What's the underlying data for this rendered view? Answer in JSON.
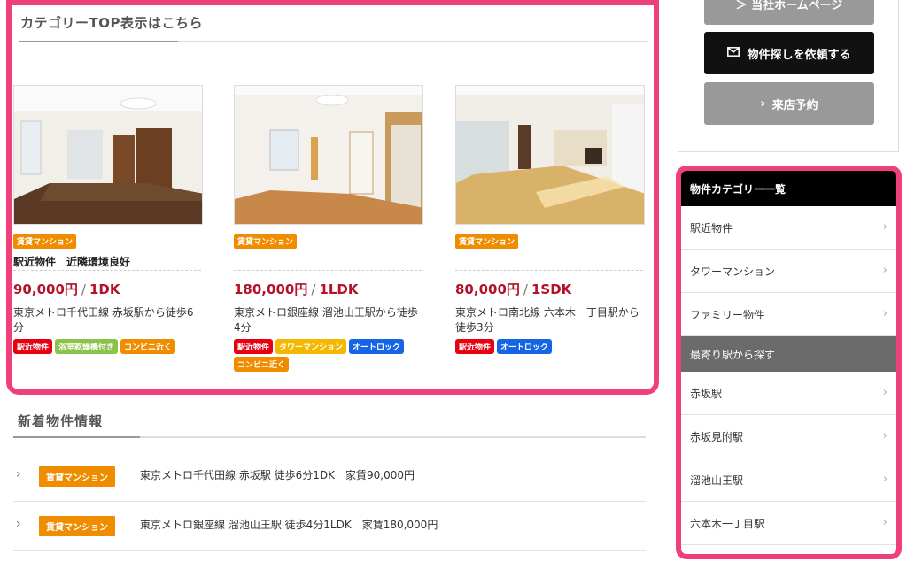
{
  "main": {
    "section_title": "カテゴリーTOP表示はこちら",
    "cards": [
      {
        "category": "賃貸マンション",
        "title": "駅近物件　近隣環境良好",
        "price": "90,000円",
        "layout": "1DK",
        "access": "東京メトロ千代田線 赤坂駅から徒歩6分",
        "tags": [
          {
            "label": "駅近物件",
            "color": "#e60012"
          },
          {
            "label": "浴室乾燥機付き",
            "color": "#8bc34a"
          },
          {
            "label": "コンビニ近く",
            "color": "#f08c00"
          }
        ]
      },
      {
        "category": "賃貸マンション",
        "title": "",
        "price": "180,000円",
        "layout": "1LDK",
        "access": "東京メトロ銀座線 溜池山王駅から徒歩4分",
        "tags": [
          {
            "label": "駅近物件",
            "color": "#e60012"
          },
          {
            "label": "タワーマンション",
            "color": "#f5b800"
          },
          {
            "label": "オートロック",
            "color": "#1565e6"
          },
          {
            "label": "コンビニ近く",
            "color": "#f08c00"
          }
        ]
      },
      {
        "category": "賃貸マンション",
        "title": "",
        "price": "80,000円",
        "layout": "1SDK",
        "access": "東京メトロ南北線 六本木一丁目駅から徒歩3分",
        "tags": [
          {
            "label": "駅近物件",
            "color": "#e60012"
          },
          {
            "label": "オートロック",
            "color": "#1565e6"
          }
        ]
      }
    ]
  },
  "news": {
    "title": "新着物件情報",
    "items": [
      {
        "category": "賃貸マンション",
        "text": "東京メトロ千代田線 赤坂駅 徒歩6分1DK　家賃90,000円"
      },
      {
        "category": "賃貸マンション",
        "text": "東京メトロ銀座線 溜池山王駅 徒歩4分1LDK　家賃180,000円"
      }
    ]
  },
  "right_buttons": {
    "top_partial": "＞ 当社ホームページ",
    "request": "物件探しを依頼する",
    "visit": "来店予約"
  },
  "sidebar": {
    "category_header": "物件カテゴリー一覧",
    "categories": [
      "駅近物件",
      "タワーマンション",
      "ファミリー物件"
    ],
    "station_header": "最寄り駅から探す",
    "stations": [
      "赤坂駅",
      "赤坂見附駅",
      "溜池山王駅",
      "六本木一丁目駅"
    ]
  },
  "colors": {
    "highlight": "#f0407a",
    "price": "#b3122a",
    "category_badge": "#f08c00"
  }
}
